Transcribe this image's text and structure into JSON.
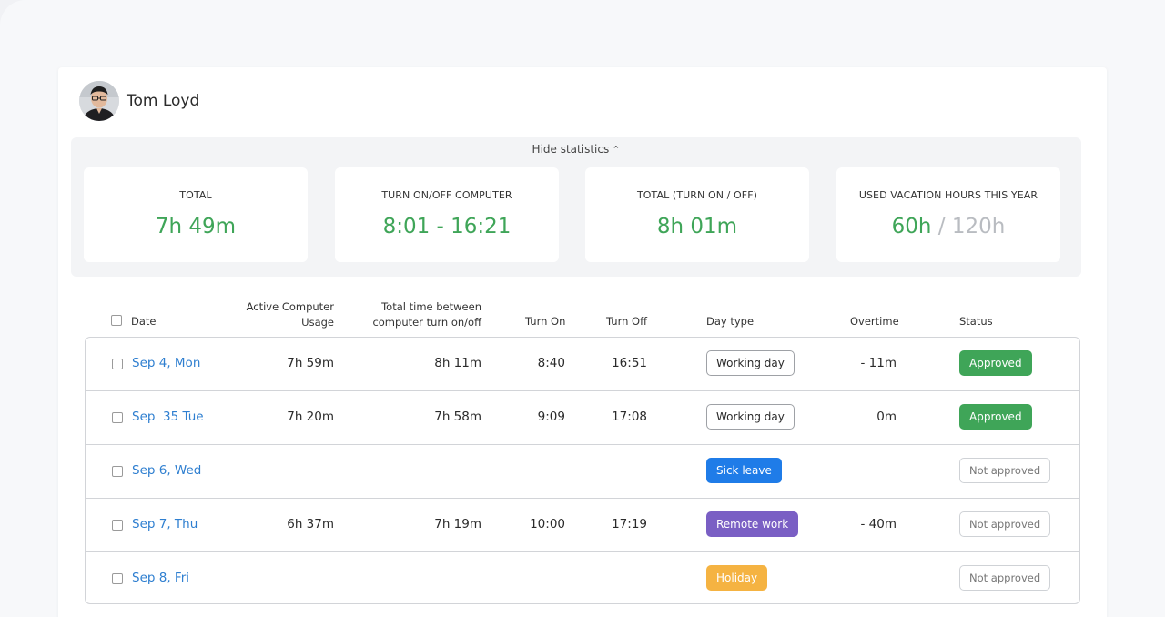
{
  "user": {
    "name": "Tom Loyd"
  },
  "statistics": {
    "toggle_label": "Hide statistics",
    "toggle_icon": "double-chevron-up-icon",
    "cards": [
      {
        "label": "TOTAL",
        "value": "7h 49m"
      },
      {
        "label": "TURN ON/OFF COMPUTER",
        "value": "8:01 - 16:21"
      },
      {
        "label": "TOTAL (TURN ON / OFF)",
        "value": "8h 01m"
      },
      {
        "label": "USED VACATION HOURS THIS YEAR",
        "value": "60h",
        "separator": "/",
        "limit": "120h"
      }
    ]
  },
  "table": {
    "headers": {
      "date": "Date",
      "active_line1": "Active Computer",
      "active_line2": "Usage",
      "total_line1": "Total time between",
      "total_line2": "computer turn on/off",
      "turn_on": "Turn On",
      "turn_off": "Turn Off",
      "day_type": "Day type",
      "overtime": "Overtime",
      "status": "Status"
    },
    "rows": [
      {
        "date": "Sep 4, Mon",
        "active": "7h 59m",
        "total": "8h 11m",
        "turn_on": "8:40",
        "turn_off": "16:51",
        "day_type": "Working day",
        "overtime": "- 11m",
        "status": "Approved"
      },
      {
        "date": "Sep  35 Tue",
        "active": "7h 20m",
        "total": "7h 58m",
        "turn_on": "9:09",
        "turn_off": "17:08",
        "day_type": "Working day",
        "overtime": "0m",
        "status": "Approved"
      },
      {
        "date": "Sep 6, Wed",
        "active": "",
        "total": "",
        "turn_on": "",
        "turn_off": "",
        "day_type": "Sick leave",
        "overtime": "",
        "status": "Not approved"
      },
      {
        "date": "Sep 7, Thu",
        "active": "6h 37m",
        "total": "7h 19m",
        "turn_on": "10:00",
        "turn_off": "17:19",
        "day_type": "Remote work",
        "overtime": "- 40m",
        "status": "Not approved"
      },
      {
        "date": "Sep 8, Fri",
        "active": "",
        "total": "",
        "turn_on": "",
        "turn_off": "",
        "day_type": "Holiday",
        "overtime": "",
        "status": "Not approved"
      }
    ]
  },
  "colors": {
    "accent_green": "#3fa558",
    "link_blue": "#2f7fd0",
    "sick_leave": "#1f7ce8",
    "remote_work": "#7a5fc4",
    "holiday": "#f5b342"
  }
}
